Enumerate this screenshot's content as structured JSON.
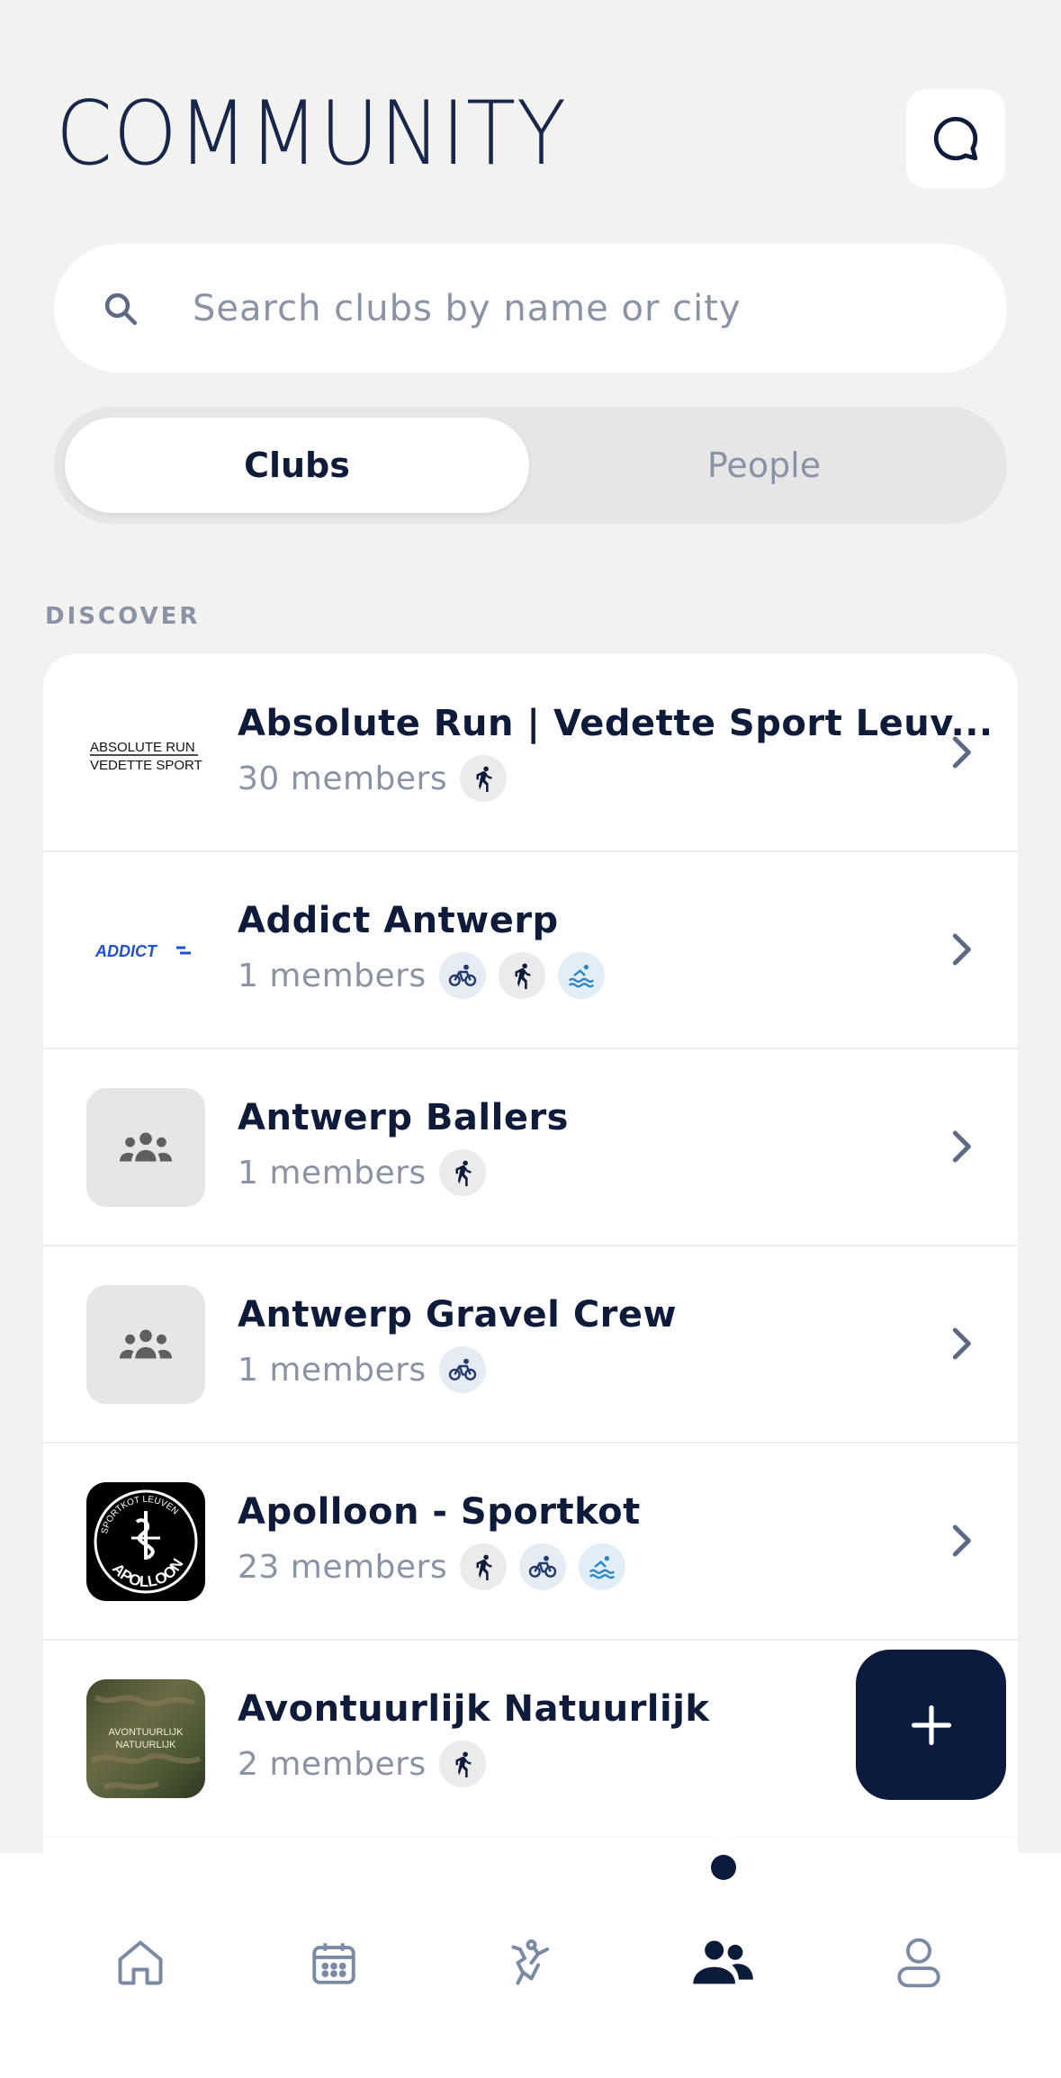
{
  "header": {
    "title": "COMMUNITY"
  },
  "search": {
    "placeholder": "Search clubs by name or city"
  },
  "segments": {
    "clubs": "Clubs",
    "people": "People"
  },
  "section": {
    "label": "DISCOVER"
  },
  "clubs": [
    {
      "name": "Absolute Run | Vedette Sport Leuv...",
      "members": "30 members",
      "sports": [
        "run"
      ],
      "logo_text": [
        "ABSOLUTE RUN",
        "VEDETTE SPORT"
      ]
    },
    {
      "name": "Addict Antwerp",
      "members": "1 members",
      "sports": [
        "bike",
        "run",
        "swim"
      ],
      "logo_text": [
        "ADDICT"
      ]
    },
    {
      "name": "Antwerp Ballers",
      "members": "1 members",
      "sports": [
        "run"
      ]
    },
    {
      "name": "Antwerp Gravel Crew",
      "members": "1 members",
      "sports": [
        "bike"
      ]
    },
    {
      "name": "Apolloon - Sportkot",
      "members": "23 members",
      "sports": [
        "run",
        "bike",
        "swim"
      ],
      "logo_text": [
        "SPORTKOT LEUVEN",
        "APOLLOON"
      ]
    },
    {
      "name": "Avontuurlijk Natuurlijk",
      "members": "2 members",
      "sports": [
        "run"
      ],
      "logo_text": [
        "AVONTUURLIJK",
        "NATUURLIJK"
      ]
    }
  ],
  "nav": [
    "home-icon",
    "calendar-icon",
    "activity-icon",
    "community-icon",
    "profile-icon"
  ],
  "colors": {
    "navy": "#0c1b3d",
    "muted": "#8a93a6",
    "background": "#f2f2f1"
  }
}
